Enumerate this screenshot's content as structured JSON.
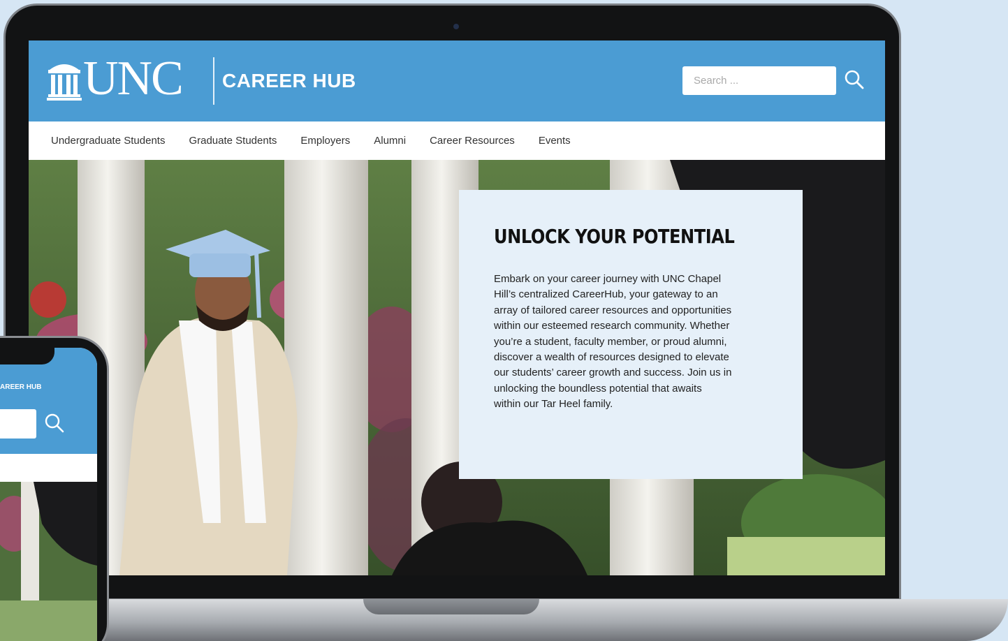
{
  "brand": {
    "logo_word": "UNC",
    "site_name": "CAREER HUB"
  },
  "search": {
    "placeholder": "Search ..."
  },
  "nav": {
    "items": [
      {
        "label": "Undergraduate Students"
      },
      {
        "label": "Graduate Students"
      },
      {
        "label": "Employers"
      },
      {
        "label": "Alumni"
      },
      {
        "label": "Career Resources"
      },
      {
        "label": "Events"
      }
    ]
  },
  "hero": {
    "title": "UNLOCK YOUR POTENTIAL",
    "body_lines": [
      "Embark on your career journey with UNC Chapel",
      "Hill’s centralized CareerHub, your gateway to an",
      "array of tailored career resources and opportunities",
      "within our esteemed research community. Whether",
      "you’re a student, faculty member, or proud alumni,",
      "discover a wealth of resources designed to elevate",
      "our students’ career growth and success. Join us in",
      "unlocking the boundless potential that awaits",
      "within our Tar Heel family."
    ]
  },
  "mobile": {
    "site_name_fragment": "AREER HUB"
  },
  "colors": {
    "brand_blue": "#4b9cd3",
    "card_bg": "#e6f0f9",
    "page_bg": "#d6e6f4"
  },
  "icons": {
    "search": "search-icon",
    "logo": "old-well-icon"
  }
}
